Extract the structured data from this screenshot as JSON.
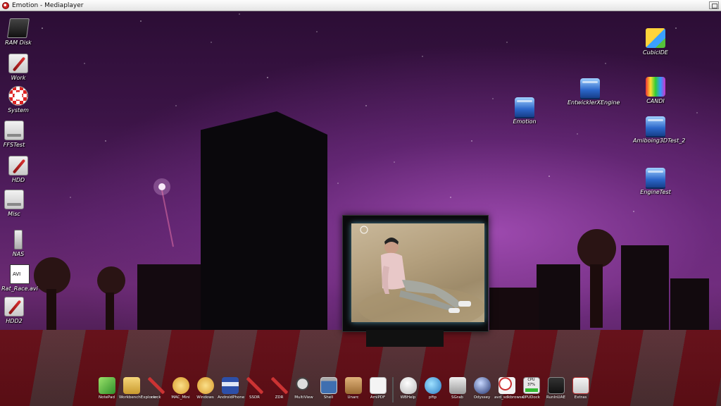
{
  "window": {
    "title": "Emotion - Mediaplayer"
  },
  "desktop_icons_left": [
    {
      "label": "RAM Disk",
      "icon": "ram-disk-icon"
    },
    {
      "label": "Work",
      "icon": "hard-drive-icon"
    },
    {
      "label": "System",
      "icon": "system-boing-icon"
    },
    {
      "label": "FFSTest",
      "icon": "drive-icon"
    },
    {
      "label": "HDD",
      "icon": "hard-drive-icon"
    },
    {
      "label": "Misc",
      "icon": "drive-icon"
    },
    {
      "label": "NAS",
      "icon": "usb-drive-icon"
    },
    {
      "label": "Rat_Race.avi",
      "icon": "avi-file-icon"
    },
    {
      "label": "HDD2",
      "icon": "hard-drive-icon"
    }
  ],
  "desktop_icons_right": [
    {
      "label": "CubicIDE",
      "icon": "cube-icon"
    },
    {
      "label": "EntwicklerXEngine",
      "icon": "drawer-icon"
    },
    {
      "label": "CANDI",
      "icon": "candi-icon"
    },
    {
      "label": "Emotion",
      "icon": "drawer-icon"
    },
    {
      "label": "Amiboing3DTest_2",
      "icon": "drawer-icon"
    },
    {
      "label": "EngineTest",
      "icon": "drawer-icon"
    }
  ],
  "dock": [
    {
      "label": "NotePad"
    },
    {
      "label": "WorkbenchExplorer"
    },
    {
      "label": "clock"
    },
    {
      "label": "MAC_Mini"
    },
    {
      "label": "Windows"
    },
    {
      "label": "AndroidPhone"
    },
    {
      "label": "SSDR"
    },
    {
      "label": "ZDR"
    },
    {
      "label": "MultiView"
    },
    {
      "label": "Shell"
    },
    {
      "label": "Unarc"
    },
    {
      "label": "AmiPDF"
    },
    {
      "label": "WBHelp"
    },
    {
      "label": "pftp"
    },
    {
      "label": "SGrab"
    },
    {
      "label": "Odyssey"
    },
    {
      "label": "avd_sdkbrowser"
    },
    {
      "label": "CPUDock"
    },
    {
      "label": "RunInUAE"
    },
    {
      "label": "Extras"
    }
  ],
  "cpudock": {
    "label": "CPU",
    "value": "37%"
  },
  "colors": {
    "sky_top": "#2a0d33",
    "sky_glow": "#a850ba",
    "titlebar": "#f0f0f0"
  }
}
